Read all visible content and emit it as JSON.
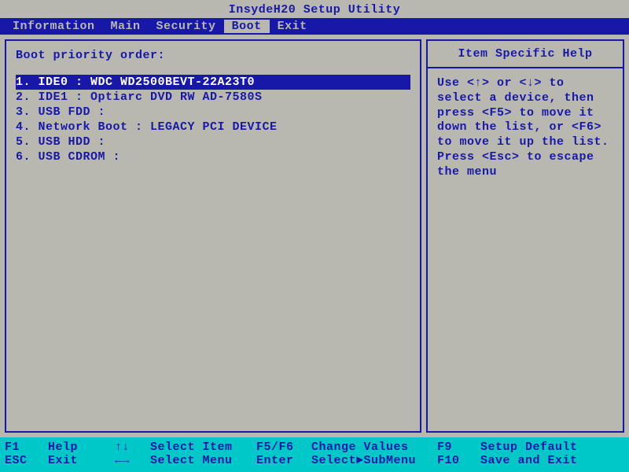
{
  "title": "InsydeH20 Setup Utility",
  "tabs": [
    {
      "label": "Information",
      "active": false
    },
    {
      "label": "Main",
      "active": false
    },
    {
      "label": "Security",
      "active": false
    },
    {
      "label": "Boot",
      "active": true
    },
    {
      "label": "Exit",
      "active": false
    }
  ],
  "boot": {
    "heading": "Boot priority order:",
    "items": [
      {
        "text": "1. IDE0 : WDC WD2500BEVT-22A23T0",
        "selected": true
      },
      {
        "text": "2. IDE1 : Optiarc DVD RW AD-7580S",
        "selected": false
      },
      {
        "text": "3. USB FDD :",
        "selected": false
      },
      {
        "text": "4. Network Boot : LEGACY PCI DEVICE",
        "selected": false
      },
      {
        "text": "5. USB HDD :",
        "selected": false
      },
      {
        "text": "6. USB CDROM :",
        "selected": false
      }
    ]
  },
  "help": {
    "title": "Item Specific Help",
    "text": "Use <↑> or <↓> to select a device, then press <F5> to move it down the list, or <F6> to move it up the list. Press <Esc> to escape the menu"
  },
  "footer": {
    "row1": {
      "k1": "F1",
      "l1": "Help",
      "arr": "↑↓",
      "act1": "Select Item",
      "k2": "F5/F6",
      "act2": "Change Values",
      "k3": "F9",
      "act3": "Setup Default"
    },
    "row2": {
      "k1": "ESC",
      "l1": "Exit",
      "arr": "←→",
      "act1": "Select Menu",
      "k2": "Enter",
      "act2": "Select►SubMenu",
      "k3": "F10",
      "act3": "Save and Exit"
    }
  }
}
